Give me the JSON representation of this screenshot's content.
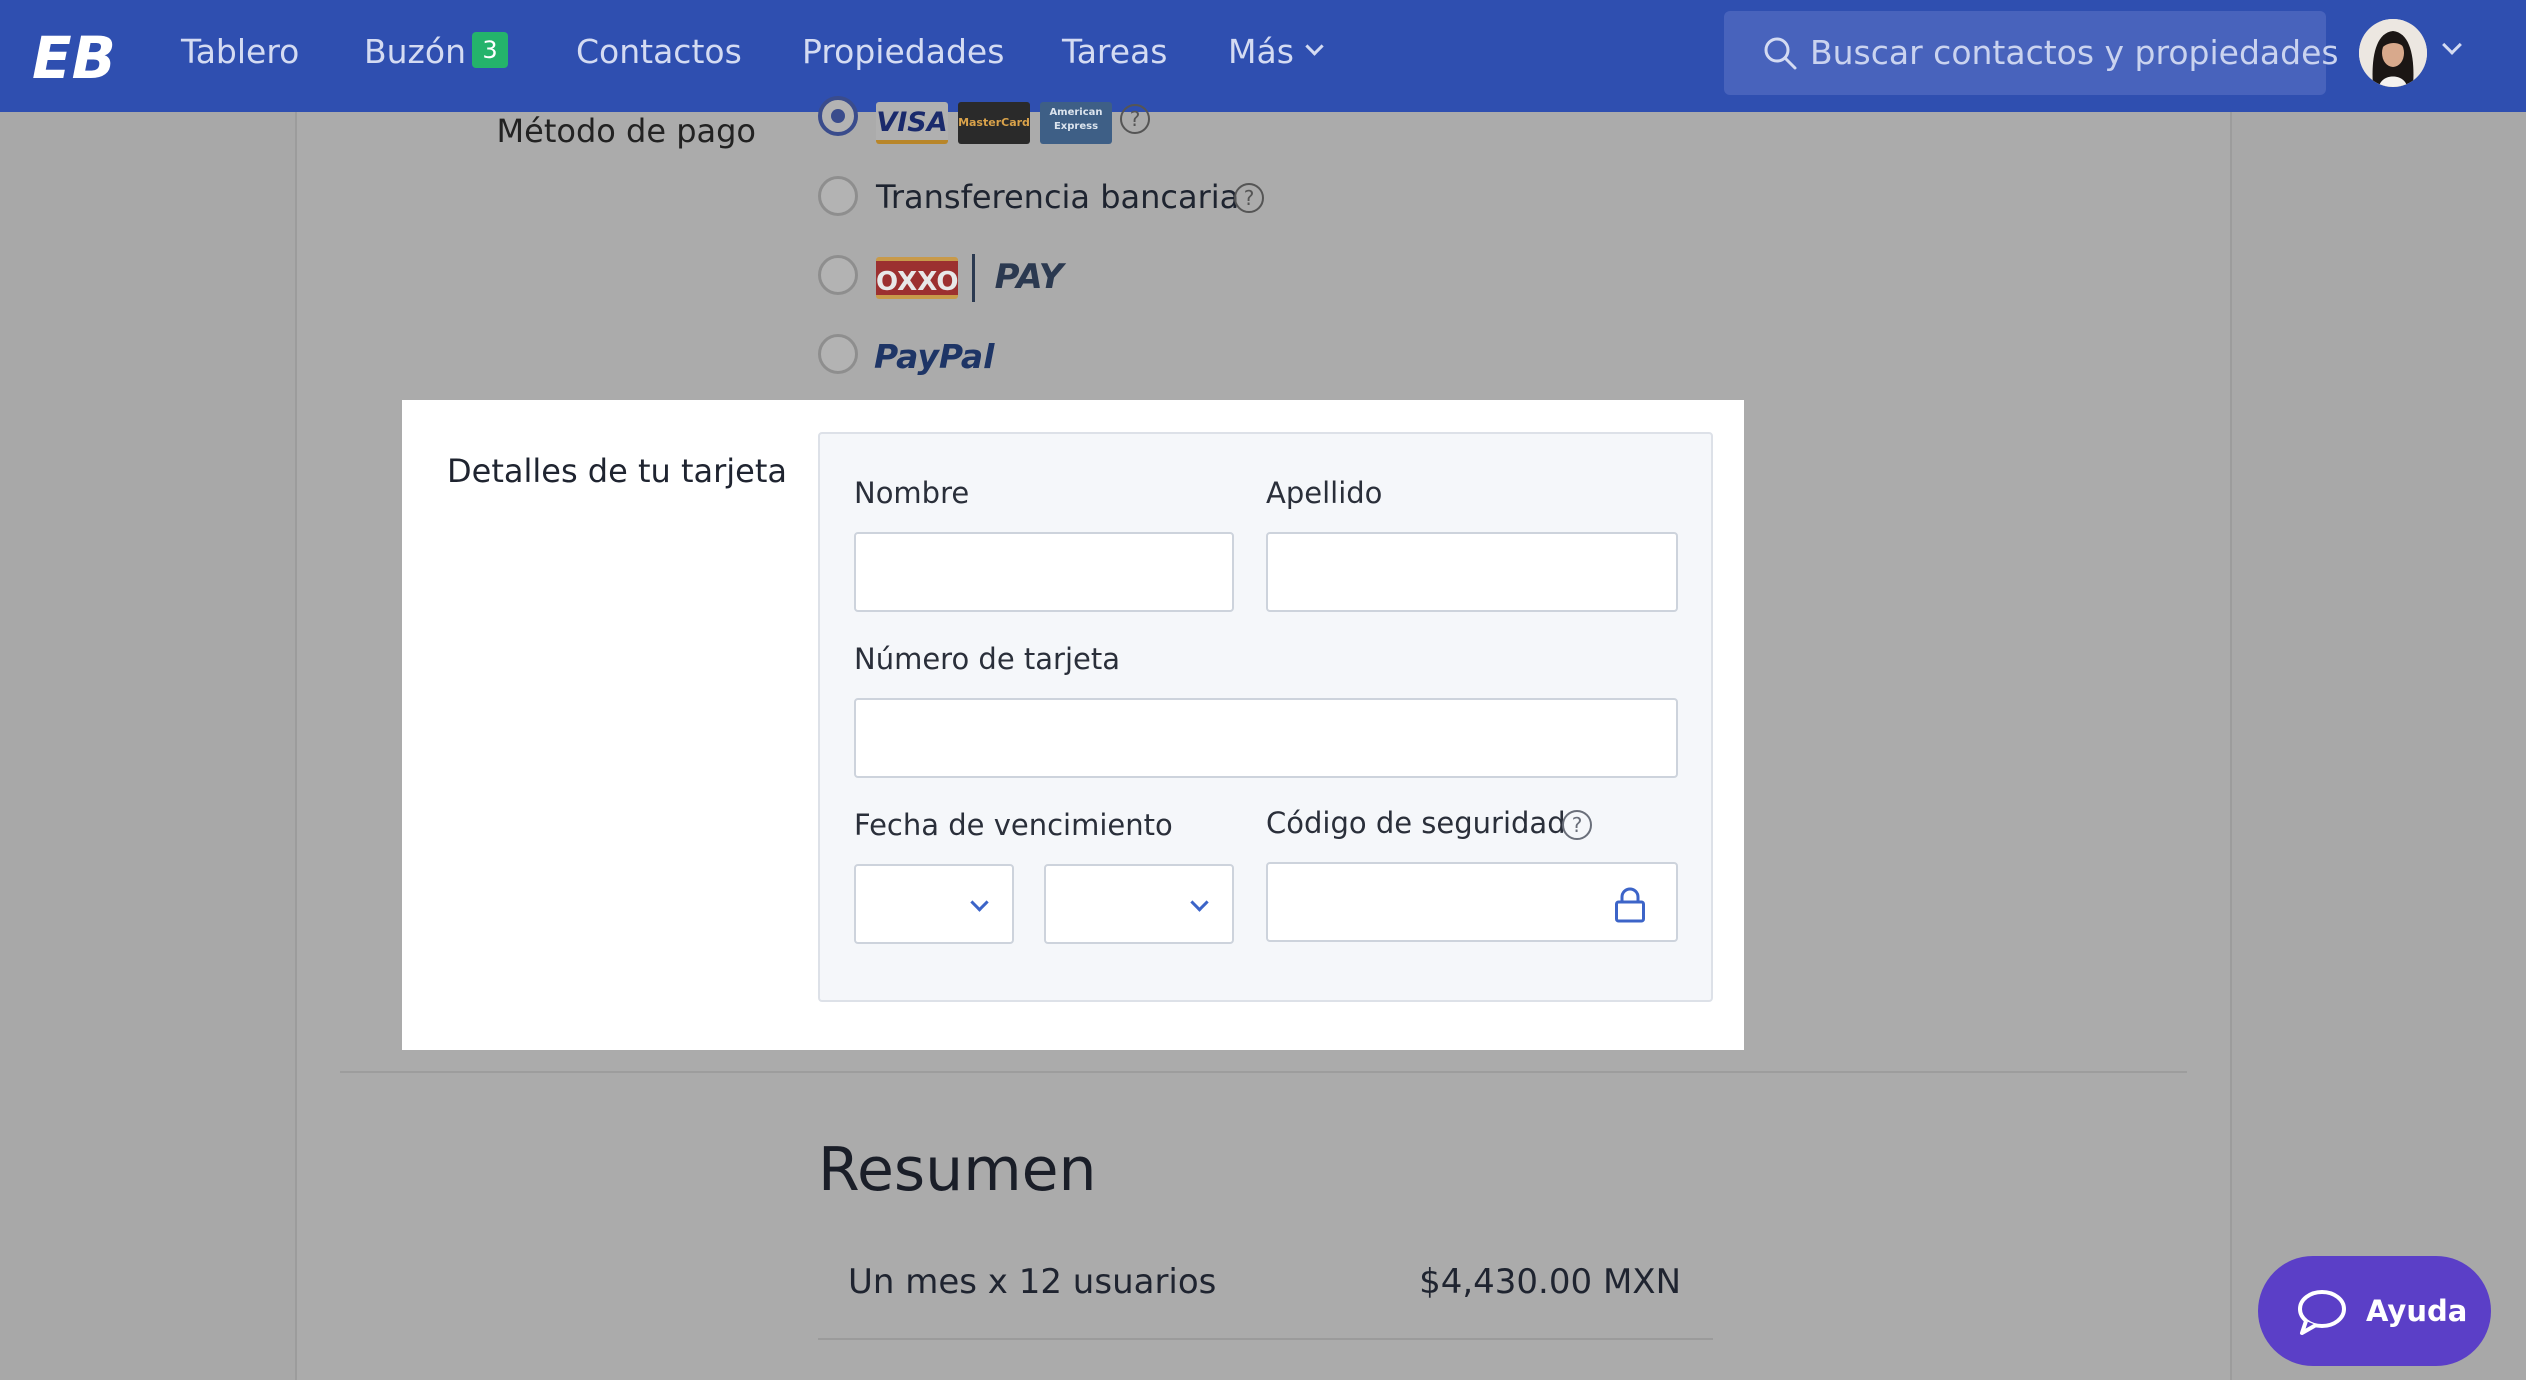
{
  "nav": {
    "logo_text": "EB",
    "items": [
      {
        "label": "Tablero"
      },
      {
        "label": "Buzón",
        "badge": "3"
      },
      {
        "label": "Contactos"
      },
      {
        "label": "Propiedades"
      },
      {
        "label": "Tareas"
      },
      {
        "label": "Más"
      }
    ],
    "search_placeholder": "Buscar contactos y propiedades"
  },
  "payment": {
    "label": "Método de pago",
    "selected": "card",
    "card_brands": [
      "VISA",
      "MasterCard",
      "American Express"
    ],
    "options": [
      {
        "id": "card",
        "label": ""
      },
      {
        "id": "transfer",
        "label": "Transferencia bancaria"
      },
      {
        "id": "oxxo",
        "label": "OXXO",
        "label2": "PAY"
      },
      {
        "id": "paypal",
        "label": "PayPal"
      }
    ]
  },
  "card_details": {
    "label": "Detalles de tu tarjeta",
    "first_name_label": "Nombre",
    "last_name_label": "Apellido",
    "card_number_label": "Número de tarjeta",
    "expiry_label": "Fecha de vencimiento",
    "cvc_label": "Código de seguridad"
  },
  "summary": {
    "title": "Resumen",
    "rows": [
      {
        "label": "Un mes x 12 usuarios",
        "value": "$4,430.00 MXN"
      }
    ]
  },
  "help_button": {
    "label": "Ayuda"
  },
  "colors": {
    "nav_bg": "#2f4fb0",
    "badge": "#24b36b",
    "help_button": "#5b3fc7",
    "accent": "#3c64c8"
  },
  "icons": [
    "search-icon",
    "chevron-down-icon",
    "help-icon",
    "lock-icon",
    "chat-icon"
  ]
}
